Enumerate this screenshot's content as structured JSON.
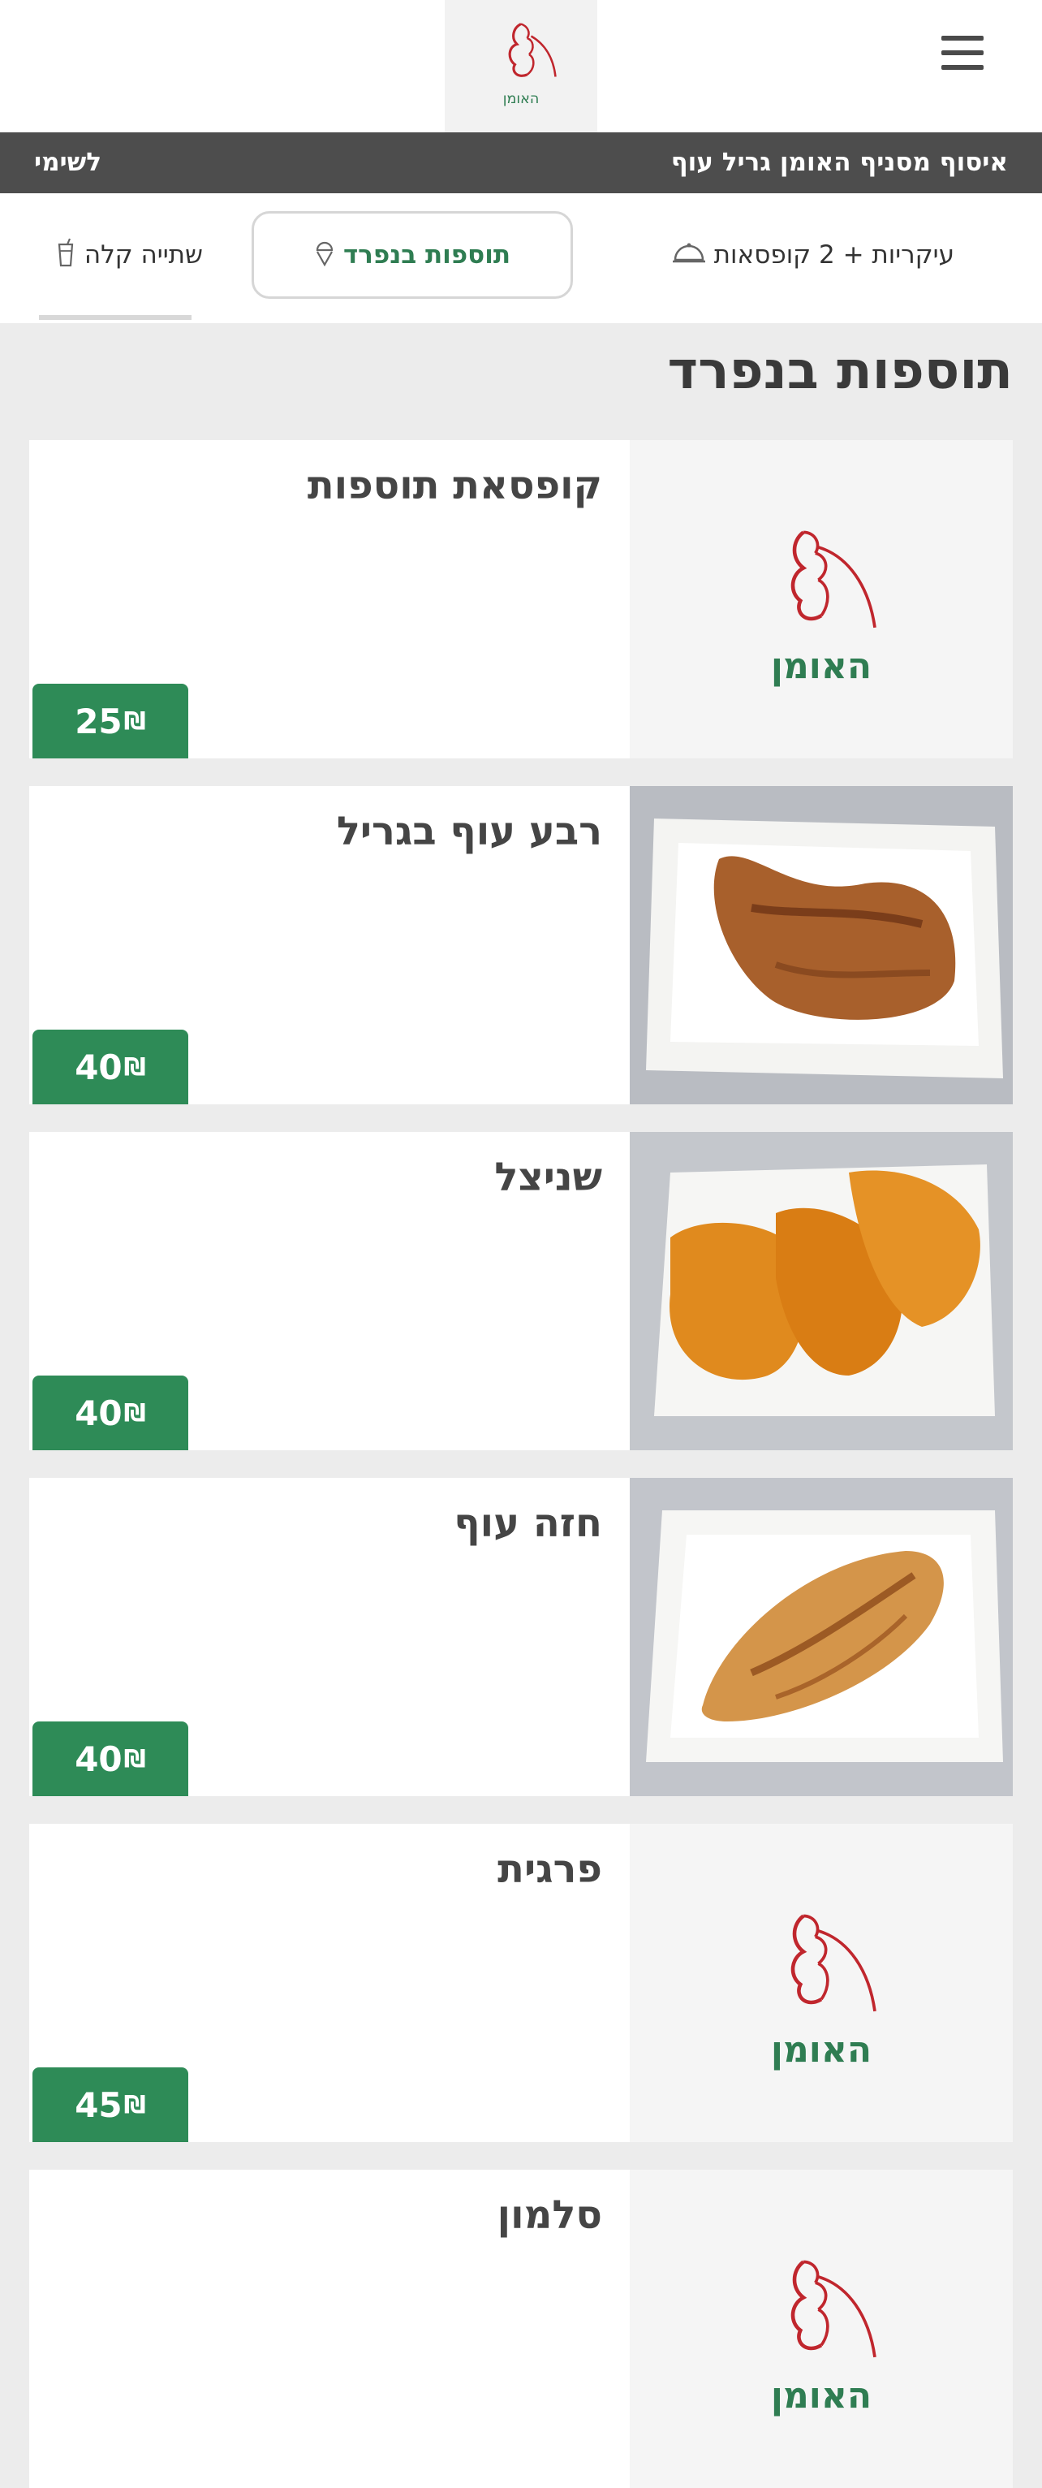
{
  "header": {
    "menu_icon": "hamburger-menu-icon",
    "logo_text": "האומן"
  },
  "status_bar": {
    "pickup_text": "איסוף מסניף האומן גריל עוף",
    "cart_label": "לשימי"
  },
  "tabs": [
    {
      "label": "עיקריות + 2 קופסאות",
      "icon": "dish-cover-icon"
    },
    {
      "label": "תוספות בנפרד",
      "icon": "ice-cream-icon",
      "active": true
    },
    {
      "label": "שתייה קלה",
      "icon": "cup-icon"
    }
  ],
  "section": {
    "title": "תוספות בנפרד"
  },
  "products": [
    {
      "name": "קופסאת תוספות",
      "price": "25",
      "currency": "₪",
      "image": "logo"
    },
    {
      "name": "רבע עוף בגריל",
      "price": "40",
      "currency": "₪",
      "image": "chicken-quarter-photo"
    },
    {
      "name": "שניצל",
      "price": "40",
      "currency": "₪",
      "image": "schnitzel-photo"
    },
    {
      "name": "חזה עוף",
      "price": "40",
      "currency": "₪",
      "image": "chicken-breast-photo"
    },
    {
      "name": "פרגית",
      "price": "45",
      "currency": "₪",
      "image": "logo"
    },
    {
      "name": "סלמון",
      "price": "",
      "currency": "₪",
      "image": "logo"
    }
  ],
  "colors": {
    "accent_green": "#2e8b57",
    "logo_red": "#c0262d",
    "status_bar_bg": "#4d4d4d"
  }
}
